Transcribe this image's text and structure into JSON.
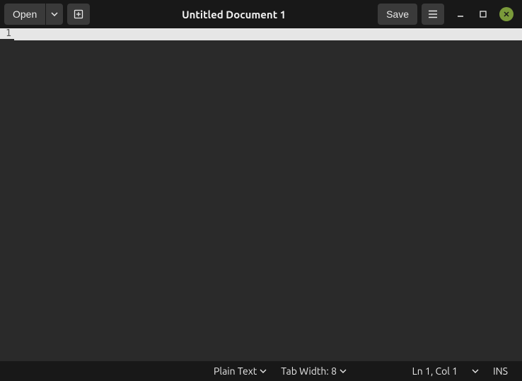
{
  "titlebar": {
    "open_label": "Open",
    "save_label": "Save",
    "document_title": "Untitled Document 1"
  },
  "editor": {
    "line_number_1": "1",
    "content": ""
  },
  "statusbar": {
    "syntax_label": "Plain Text",
    "tab_width_label": "Tab Width: 8",
    "cursor_position": "Ln 1, Col 1",
    "insert_mode": "INS"
  }
}
